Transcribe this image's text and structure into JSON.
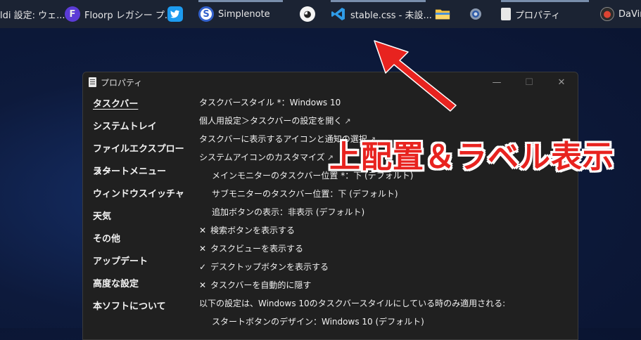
{
  "taskbar": {
    "items": [
      {
        "label": "ldi 設定: ウェ...",
        "icon": "vivaldi-settings-icon"
      },
      {
        "label": "Floorp レガシー プ...",
        "icon": "floorp-icon"
      },
      {
        "label": "",
        "icon": "twitter-icon"
      },
      {
        "label": "Simplenote",
        "icon": "simplenote-icon"
      },
      {
        "label": "",
        "icon": "cat-app-icon"
      },
      {
        "label": "stable.css - 未設...",
        "icon": "vscode-icon"
      },
      {
        "label": "",
        "icon": "file-explorer-icon"
      },
      {
        "label": "",
        "icon": "settings-gear-icon"
      },
      {
        "label": "プロパティ",
        "icon": "properties-icon"
      },
      {
        "label": "DaVin",
        "icon": "davinci-icon"
      }
    ]
  },
  "window": {
    "title": "プロパティ",
    "controls": {
      "minimize": "—",
      "maximize": "☐",
      "close": "✕"
    }
  },
  "sidebar": {
    "items": [
      {
        "label": "タスクバー",
        "selected": true
      },
      {
        "label": "システムトレイ"
      },
      {
        "label": "ファイルエクスプローラー"
      },
      {
        "label": "スタートメニュー"
      },
      {
        "label": "ウィンドウスイッチャー"
      },
      {
        "label": "天気"
      },
      {
        "label": "その他"
      },
      {
        "label": "アップデート"
      },
      {
        "label": "高度な設定"
      },
      {
        "label": "本ソフトについて"
      }
    ]
  },
  "content": {
    "rows": [
      {
        "text": "タスクバースタイル *：Windows 10"
      },
      {
        "text": "個人用設定＞タスクバーの設定を開く",
        "ext": "↗"
      },
      {
        "text": "タスクバーに表示するアイコンと通知の選択",
        "ext": "↗"
      },
      {
        "text": "システムアイコンのカスタマイズ",
        "ext": "↗"
      },
      {
        "text": "メインモニターのタスクバー位置 *：下 (デフォルト)",
        "indent": true
      },
      {
        "text": "サブモニターのタスクバー位置：下 (デフォルト)",
        "indent": true
      },
      {
        "text": "追加ボタンの表示：非表示 (デフォルト)",
        "indent": true
      },
      {
        "mark": "✕",
        "text": "検索ボタンを表示する"
      },
      {
        "mark": "✕",
        "text": "タスクビューを表示する"
      },
      {
        "mark": "✓",
        "text": "デスクトップボタンを表示する"
      },
      {
        "mark": "✕",
        "text": "タスクバーを自動的に隠す"
      },
      {
        "text": "以下の設定は、Windows 10のタスクバースタイルにしている時のみ適用される:"
      },
      {
        "text": "スタートボタンのデザイン：Windows 10 (デフォルト)",
        "indent": true
      }
    ]
  },
  "annotation": {
    "text": "上配置＆ラベル表示",
    "color": "#e8231f"
  }
}
